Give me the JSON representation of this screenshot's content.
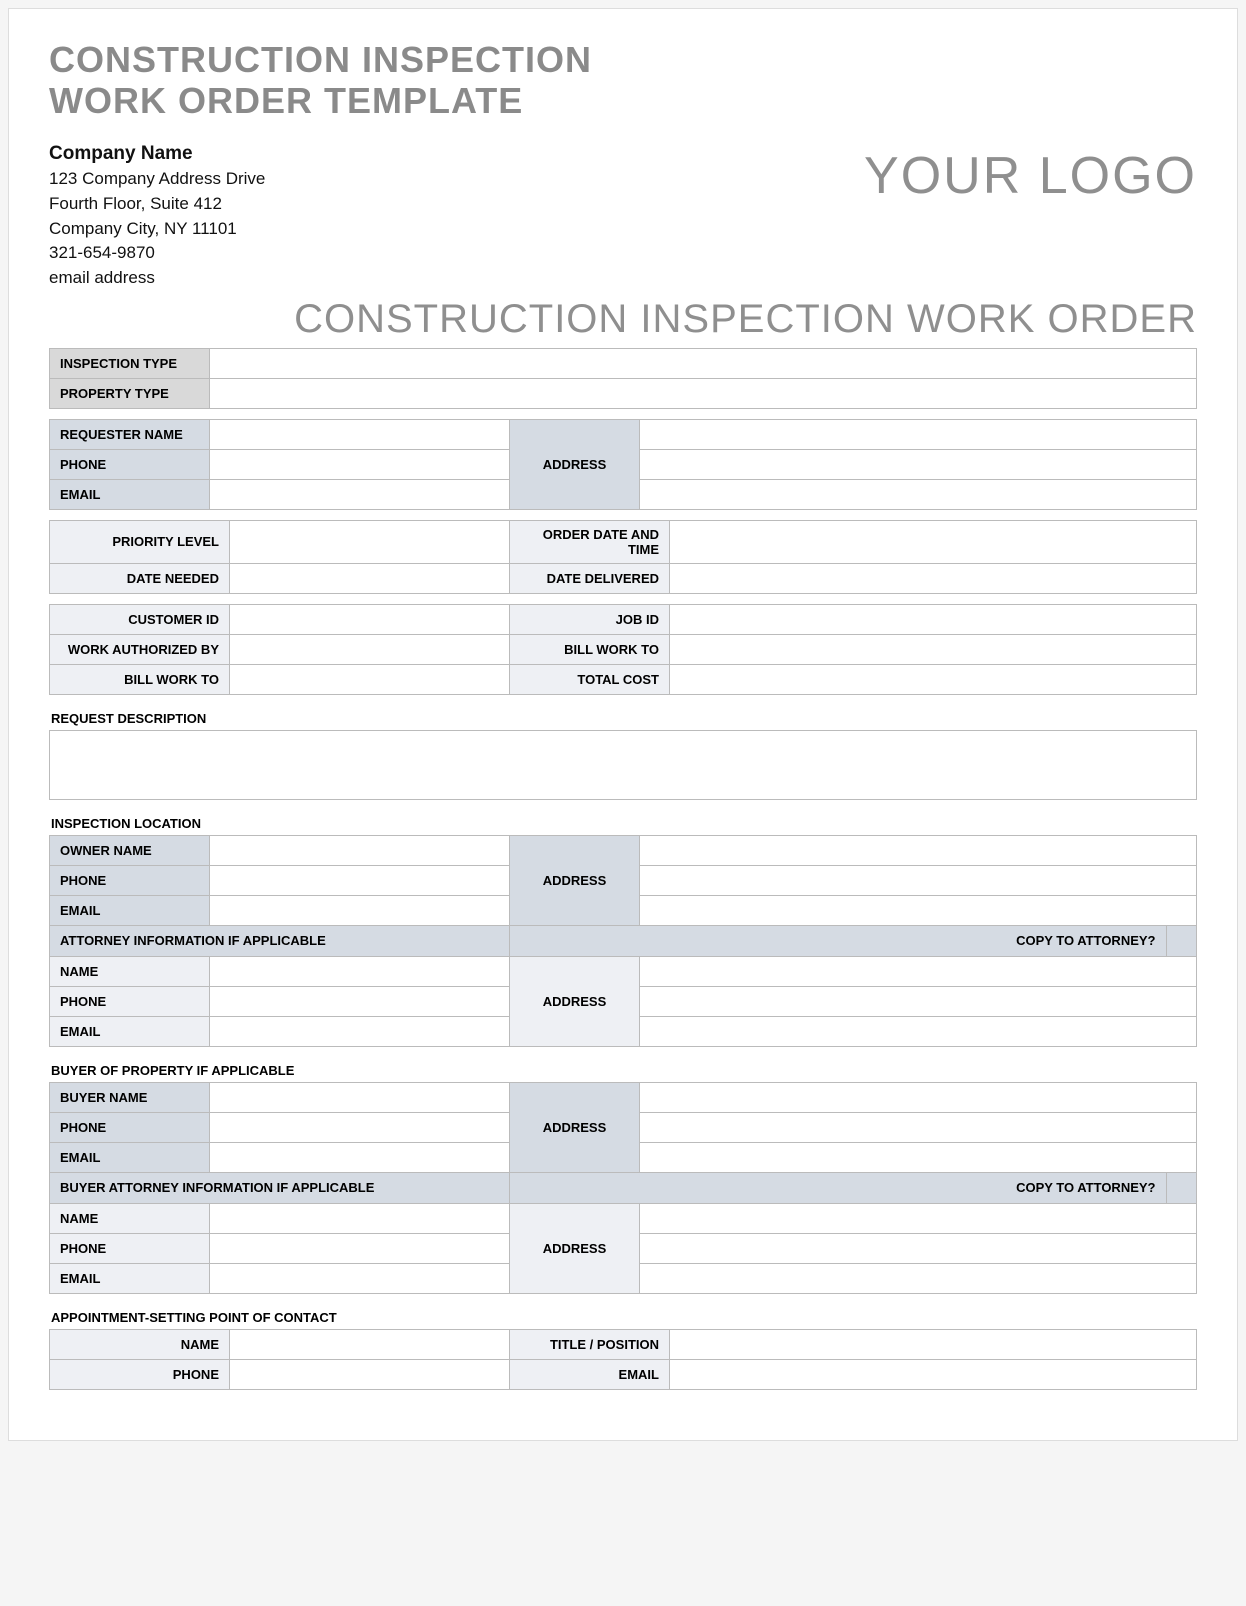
{
  "title_line1": "CONSTRUCTION INSPECTION",
  "title_line2": "WORK ORDER TEMPLATE",
  "company": {
    "name": "Company Name",
    "addr1": "123 Company Address Drive",
    "addr2": "Fourth Floor, Suite 412",
    "addr3": "Company City, NY  11101",
    "phone": "321-654-9870",
    "email": "email address"
  },
  "logo_text": "YOUR LOGO",
  "form_title": "CONSTRUCTION INSPECTION WORK ORDER",
  "labels": {
    "inspection_type": "INSPECTION TYPE",
    "property_type": "PROPERTY TYPE",
    "requester_name": "REQUESTER NAME",
    "phone": "PHONE",
    "email": "EMAIL",
    "address": "ADDRESS",
    "priority_level": "PRIORITY LEVEL",
    "date_needed": "DATE NEEDED",
    "order_date_time": "ORDER DATE AND TIME",
    "date_delivered": "DATE DELIVERED",
    "customer_id": "CUSTOMER ID",
    "work_authorized_by": "WORK AUTHORIZED BY",
    "bill_work_to": "BILL WORK TO",
    "job_id": "JOB ID",
    "bill_work_to2": "BILL WORK TO",
    "total_cost": "TOTAL COST",
    "request_description": "REQUEST DESCRIPTION",
    "inspection_location": "INSPECTION LOCATION",
    "owner_name": "OWNER NAME",
    "attorney_info": "ATTORNEY INFORMATION IF APPLICABLE",
    "copy_to_attorney": "COPY TO ATTORNEY?",
    "name": "NAME",
    "buyer_section": "BUYER OF PROPERTY IF APPLICABLE",
    "buyer_name": "BUYER NAME",
    "buyer_attorney_info": "BUYER ATTORNEY INFORMATION IF APPLICABLE",
    "appointment_section": "APPOINTMENT-SETTING POINT OF CONTACT",
    "title_position": "TITLE / POSITION"
  }
}
